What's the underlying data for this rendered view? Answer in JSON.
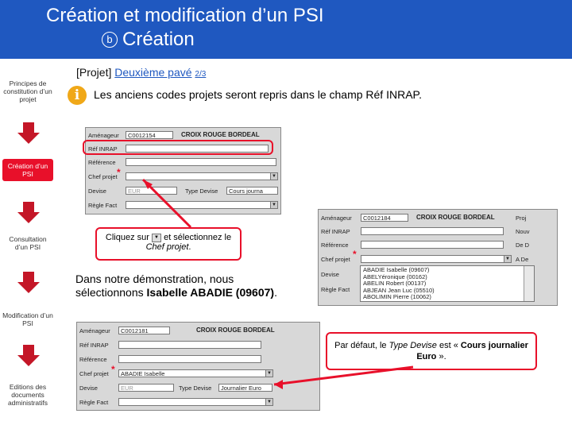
{
  "header": {
    "title_line1": "Création et modification d’un PSI",
    "step_symbol": "b",
    "title_line2": "Création",
    "bg_color": "#1f58c0"
  },
  "steps": [
    {
      "label": "Principes de constitution d’un projet",
      "active": false
    },
    {
      "label": "Création d’un PSI",
      "active": true
    },
    {
      "label": "Consultation d’un PSI",
      "active": false
    },
    {
      "label": "Modification d’un PSI",
      "active": false
    },
    {
      "label": "Editions des documents administratifs",
      "active": false
    }
  ],
  "breadcrumb": {
    "prefix": "[Projet]",
    "link": "Deuxième pavé",
    "page": "2/3"
  },
  "info_note": "Les anciens codes projets seront repris dans le champ Réf INRAP.",
  "form1": {
    "amenageur_label": "Aménageur",
    "amenageur_code": "C0012154",
    "organisation": "CROIX ROUGE BORDEAL",
    "ref_inrap_label": "Réf INRAP",
    "reference_label": "Référence",
    "chef_label": "Chef projet",
    "devise_label": "Devise",
    "devise_value": "EUR",
    "type_devise_label": "Type Devise",
    "type_devise_value": "Cours journa",
    "regle_label": "Règle Fact"
  },
  "callout1": {
    "text_before": "Cliquez sur",
    "text_after": "et sélectionnez le",
    "emph": "Chef projet",
    "end": "."
  },
  "form2": {
    "amenageur_label": "Aménageur",
    "amenageur_code": "C0012184",
    "organisation": "CROIX ROUGE BORDEAL",
    "ref_inrap_label": "Réf INRAP",
    "reference_label": "Référence",
    "chef_label": "Chef projet",
    "devise_label": "Devise",
    "regle_label": "Règle Fact",
    "side_labels": [
      "Proj",
      "Nouv",
      "De D",
      "A De"
    ],
    "options": [
      "ABADIE Isabelle     (09607)",
      "ABELYéronique      (00162)",
      "ABELIN Robert      (00137)",
      "ABJEAN Jean Luc    (05510)",
      "ABOLIMIN Pierre    (10062)"
    ]
  },
  "demo": {
    "line1": "Dans notre démonstration, nous",
    "line2_before": "sélectionnons",
    "line2_bold": "Isabelle ABADIE (09607)",
    "line2_end": "."
  },
  "form3": {
    "amenageur_label": "Aménageur",
    "amenageur_code": "C0012181",
    "organisation": "CROIX ROUGE BORDEAL",
    "ref_inrap_label": "Réf INRAP",
    "reference_label": "Référence",
    "chef_label": "Chef projet",
    "chef_value": "ABADIE Isabelle",
    "devise_label": "Devise",
    "devise_value": "EUR",
    "type_devise_label": "Type Devise",
    "type_devise_value": "Journalier Euro",
    "regle_label": "Règle Fact"
  },
  "tip": {
    "before": "Par défaut, le",
    "emph": "Type Devise",
    "middle": "est «",
    "bold": "Cours journalier Euro",
    "end": "»."
  },
  "accent_color": "#e8102a"
}
